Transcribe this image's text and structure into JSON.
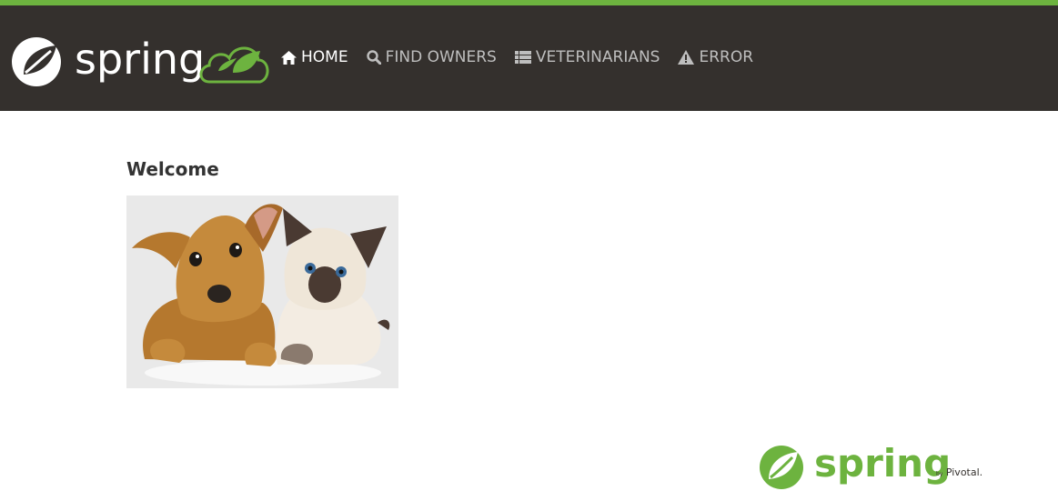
{
  "header": {
    "brand_text": "spring",
    "nav": [
      {
        "label": "HOME",
        "icon": "home-icon",
        "active": true
      },
      {
        "label": "FIND OWNERS",
        "icon": "search-icon",
        "active": false
      },
      {
        "label": "VETERINARIANS",
        "icon": "list-icon",
        "active": false
      },
      {
        "label": "ERROR",
        "icon": "warning-icon",
        "active": false
      }
    ]
  },
  "main": {
    "title": "Welcome"
  },
  "footer": {
    "brand_text": "spring",
    "byline_by": "by",
    "byline_company": "Pivotal."
  },
  "colors": {
    "accent_green": "#6db33f",
    "navbar_bg": "#34302d",
    "nav_text": "#bebebe",
    "nav_active": "#ffffff"
  }
}
